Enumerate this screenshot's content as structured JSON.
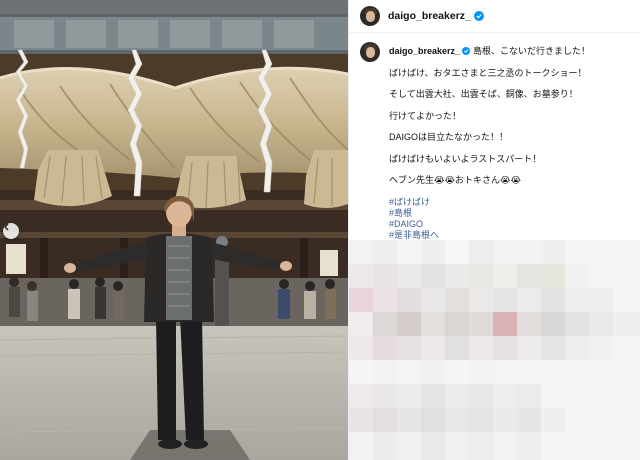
{
  "post": {
    "username": "daigo_breakerz_",
    "caption_lines": [
      "島根、こないだ行きました！",
      "",
      "ばけばけ、おタエさまと三之丞のトークショー！",
      "",
      "そして出雲大社、出雲そば、銅像、お墓参り！",
      "",
      "行けてよかった！",
      "",
      "DAIGOは目立たなかった！！",
      "",
      "ばけばけもいよいよラストスパート！",
      "",
      "ヘブン先生😭😭おトキさん😭😭"
    ],
    "hashtags": [
      "#ばけばけ",
      "#島根",
      "#DAIGO",
      "#是非島根へ"
    ]
  },
  "colors": {
    "verified": "#0095f6",
    "hashtag": "#3a5c94",
    "divider": "#efefef"
  },
  "icons": {
    "verified": "verified-badge-icon",
    "prev": "chevron-left-icon"
  }
}
